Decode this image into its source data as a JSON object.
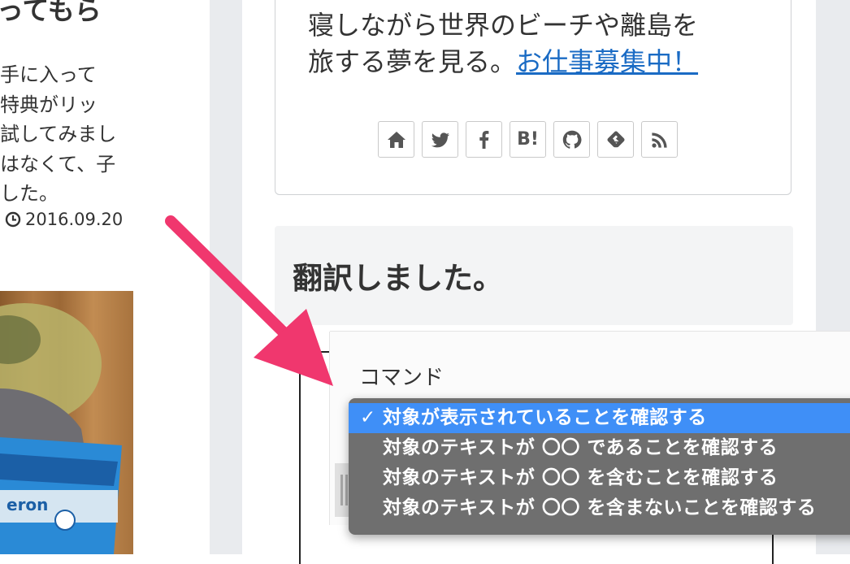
{
  "left_article": {
    "title": "ってもら",
    "excerpt_lines": [
      "手に入って",
      "特典がリッ",
      "試してみまし",
      "はなくて、子",
      "した。"
    ],
    "date": "2016.09.20"
  },
  "sidebar": {
    "profile": {
      "line1": "寝しながら世界のビーチや離島を",
      "line2_prefix": "旅する夢を見る。",
      "hire_link": "お仕事募集中！"
    },
    "social_buttons": [
      {
        "icon": "home-icon"
      },
      {
        "icon": "twitter-icon"
      },
      {
        "icon": "facebook-icon"
      },
      {
        "icon": "hatena-bookmark-icon",
        "text": "B!"
      },
      {
        "icon": "github-icon"
      },
      {
        "icon": "feedly-icon"
      },
      {
        "icon": "rss-icon"
      }
    ],
    "translate_title": "翻訳しました。"
  },
  "command_panel": {
    "label": "コマンド",
    "options": [
      "対象が表示されていることを確認する",
      "対象のテキストが 〇〇 であることを確認する",
      "対象のテキストが 〇〇 を含むことを確認する",
      "対象のテキストが 〇〇 を含まないことを確認する"
    ],
    "selected_check": "✓"
  },
  "colors": {
    "arrow": "#f0376e",
    "menu_bg": "#6f6f6f",
    "menu_selected": "#3f8ff7",
    "link": "#1a6bc4",
    "sidebar_bg": "#e9ebee"
  }
}
